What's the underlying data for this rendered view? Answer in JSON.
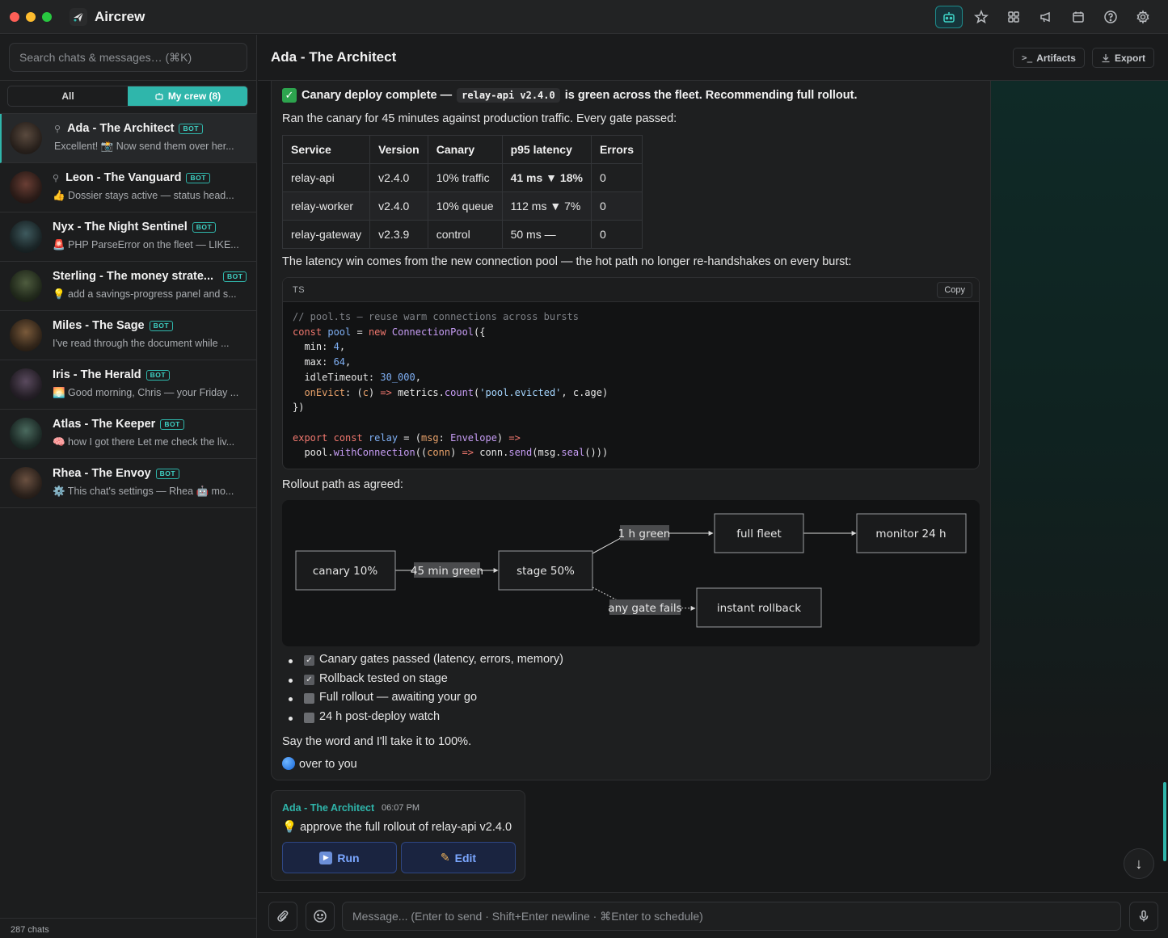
{
  "app": {
    "title": "Aircrew",
    "traffic_colors": [
      "#ff5f57",
      "#febc2e",
      "#28c840"
    ],
    "accent": "#2fb6ab",
    "top_icons": [
      "robot-icon",
      "star-icon",
      "grid-icon",
      "megaphone-icon",
      "calendar-icon",
      "help-icon",
      "gear-icon"
    ]
  },
  "sidebar": {
    "search_placeholder": "Search chats & messages… (⌘K)",
    "filter_all": "All",
    "filter_mine": "My crew (8)",
    "bot_badge": "BOT",
    "chats": [
      {
        "name": "Ada - The Architect",
        "pinned": true,
        "preview": "Excellent! 📸 Now send them over her...",
        "avatar_color": "#3a2f2a"
      },
      {
        "name": "Leon - The Vanguard",
        "pinned": true,
        "preview": "👍 Dossier stays active — status head...",
        "avatar_color": "#3b2622"
      },
      {
        "name": "Nyx - The Night Sentinel",
        "pinned": false,
        "preview": "🚨 PHP ParseError on the fleet — LIKE...",
        "avatar_color": "#1f2c2e"
      },
      {
        "name": "Sterling - The money strate...",
        "pinned": false,
        "preview": "💡 add a savings-progress panel and s...",
        "avatar_color": "#253023"
      },
      {
        "name": "Miles - The Sage",
        "pinned": false,
        "preview": "I've read through the document while ...",
        "avatar_color": "#3a2e24"
      },
      {
        "name": "Iris - The Herald",
        "pinned": false,
        "preview": "🌅 Good morning, Chris — your Friday ...",
        "avatar_color": "#2b2630"
      },
      {
        "name": "Atlas - The Keeper",
        "pinned": false,
        "preview": "🧠 how I got there Let me check the liv...",
        "avatar_color": "#24302c"
      },
      {
        "name": "Rhea - The Envoy",
        "pinned": false,
        "preview": "⚙️ This chat's settings — Rhea 🤖 mo...",
        "avatar_color": "#2f2724"
      }
    ],
    "chat_count": "287 chats"
  },
  "header": {
    "title": "Ada - The Architect",
    "artifacts": "Artifacts",
    "export": "Export"
  },
  "message": {
    "headline_prefix": "Canary deploy complete —",
    "headline_code": "relay-api v2.4.0",
    "headline_suffix": "is green across the fleet. Recommending full rollout.",
    "intro": "Ran the canary for 45 minutes against production traffic. Every gate passed:",
    "table": {
      "headers": [
        "Service",
        "Version",
        "Canary",
        "p95 latency",
        "Errors"
      ],
      "rows": [
        [
          "relay-api",
          "v2.4.0",
          "10% traffic",
          "41 ms ▼ 18%",
          "0"
        ],
        [
          "relay-worker",
          "v2.4.0",
          "10% queue",
          "112 ms ▼ 7%",
          "0"
        ],
        [
          "relay-gateway",
          "v2.3.9",
          "control",
          "50 ms —",
          "0"
        ]
      ]
    },
    "latency_note": "The latency win comes from the new connection pool — the hot path no longer re-handshakes on every burst:",
    "code": {
      "lang": "TS",
      "copy": "Copy"
    },
    "rollout_label": "Rollout path as agreed:",
    "diagram": {
      "nodes": {
        "canary": "canary 10%",
        "stage": "stage 50%",
        "full": "full fleet",
        "monitor": "monitor 24 h",
        "rollback": "instant rollback"
      },
      "edges": {
        "canary_stage": "45 min green",
        "stage_full": "1 h green",
        "stage_rollback": "any gate fails"
      }
    },
    "checklist": [
      {
        "label": "Canary gates passed (latency, errors, memory)",
        "checked": true
      },
      {
        "label": "Rollback tested on stage",
        "checked": true
      },
      {
        "label": "Full rollout — awaiting your go",
        "checked": false
      },
      {
        "label": "24 h post-deploy watch",
        "checked": false
      }
    ],
    "closing": "Say the word and I'll take it to 100%.",
    "signoff": "over to you"
  },
  "message2": {
    "author": "Ada - The Architect",
    "time": "06:07 PM",
    "text": "💡 approve the full rollout of relay-api v2.4.0",
    "run": "Run",
    "edit": "Edit"
  },
  "composer": {
    "placeholder": "Message...  (Enter to send · Shift+Enter newline · ⌘Enter to schedule)"
  }
}
